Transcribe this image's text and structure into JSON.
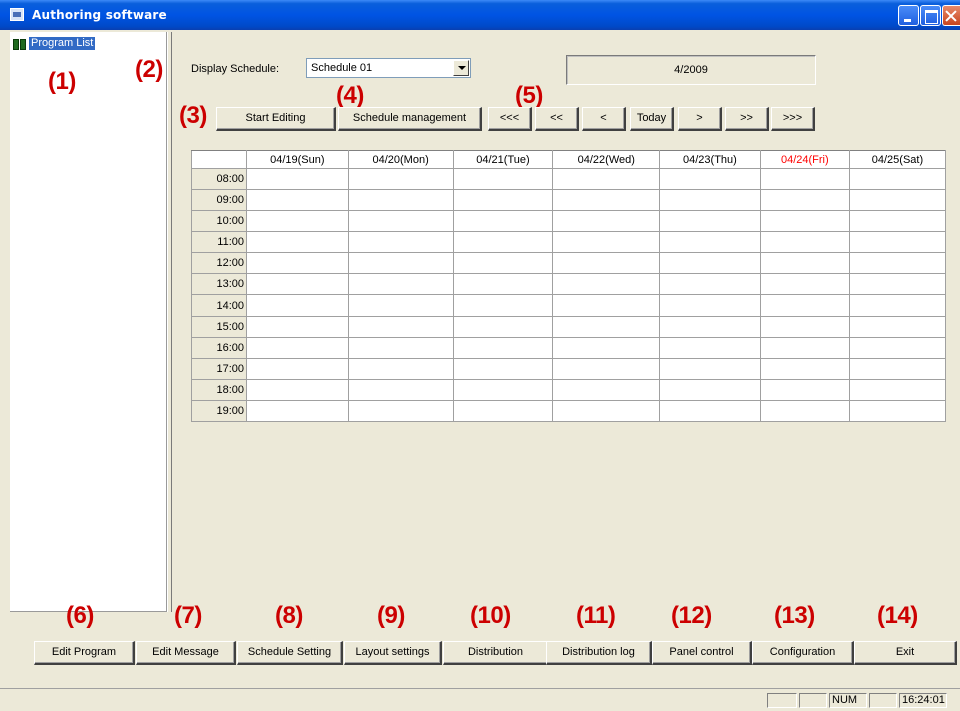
{
  "window": {
    "title": "Authoring software"
  },
  "tree": {
    "root_label": "Program List"
  },
  "callouts": [
    "(1)",
    "(2)",
    "(3)",
    "(4)",
    "(5)",
    "(6)",
    "(7)",
    "(8)",
    "(9)",
    "(10)",
    "(11)",
    "(12)",
    "(13)",
    "(14)"
  ],
  "schedule": {
    "display_label": "Display Schedule:",
    "selected": "Schedule 01",
    "month": "4/2009"
  },
  "toolbar": {
    "start_editing": "Start Editing",
    "schedule_management": "Schedule management",
    "nav": [
      "<<<",
      "<<",
      "<",
      "Today",
      ">",
      ">>",
      ">>>"
    ]
  },
  "calendar": {
    "days": [
      "04/19(Sun)",
      "04/20(Mon)",
      "04/21(Tue)",
      "04/22(Wed)",
      "04/23(Thu)",
      "04/24(Fri)",
      "04/25(Sat)"
    ],
    "highlight_day": "04/24(Fri)",
    "highlight_color": "#ff0000",
    "times": [
      "08:00",
      "09:00",
      "10:00",
      "11:00",
      "12:00",
      "13:00",
      "14:00",
      "15:00",
      "16:00",
      "17:00",
      "18:00",
      "19:00"
    ]
  },
  "bottom_buttons": [
    "Edit Program",
    "Edit Message",
    "Schedule Setting",
    "Layout settings",
    "Distribution",
    "Distribution log",
    "Panel control",
    "Configuration",
    "Exit"
  ],
  "status": {
    "num": "NUM",
    "clock": "16:24:01"
  },
  "colors": {
    "title_bar": "#0054e3",
    "callout": "#cc0000",
    "selection": "#316ac5"
  }
}
